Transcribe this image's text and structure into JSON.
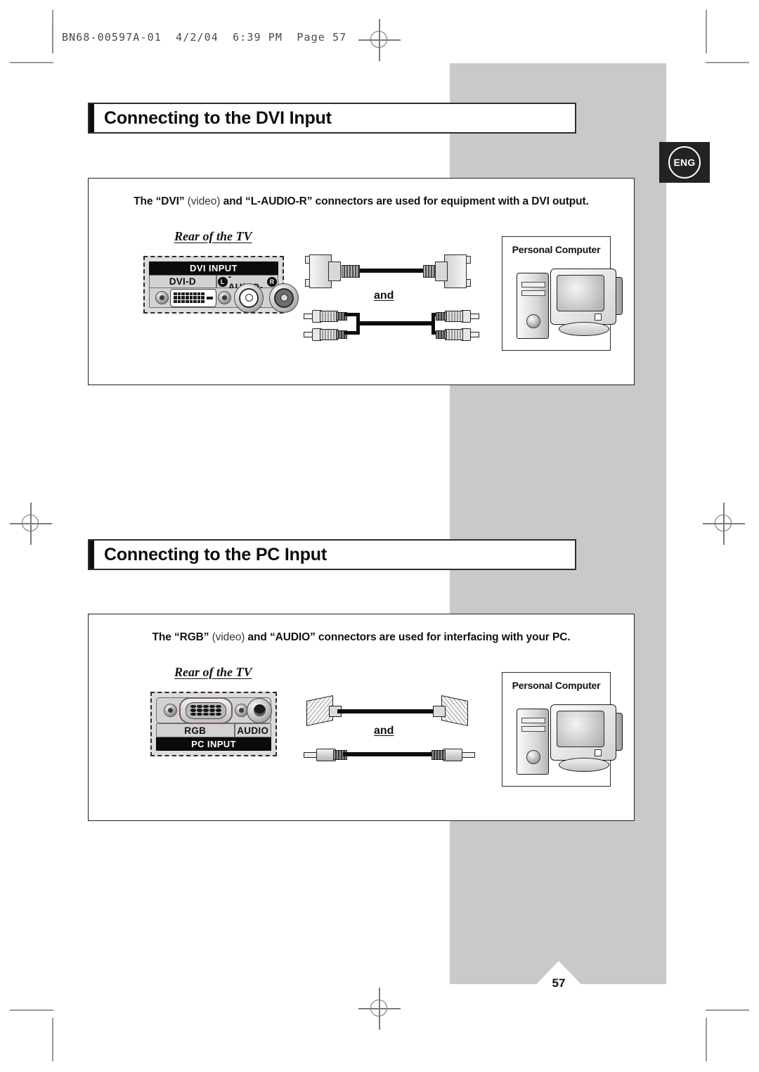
{
  "print_header": {
    "text": "BN68-00597A-01  4/2/04  6:39 PM  Page 57"
  },
  "language_badge": {
    "label": "ENG"
  },
  "sections": [
    {
      "id": "dvi",
      "title": "Connecting to the DVI Input",
      "description_prefix": "The “DVI” ",
      "description_light": "(video)",
      "description_suffix": " and “L-AUDIO-R” connectors are used for equipment with a DVI output.",
      "rear_label": "Rear of the TV",
      "panel": {
        "header_bar": "DVI INPUT",
        "label_left": "DVI-D",
        "label_right_text": "-AUDIO-",
        "label_right_l": "L",
        "label_right_r": "R",
        "header_position": "top"
      },
      "cable": {
        "connector_word": "and",
        "top_cable": "dvi-cable",
        "bottom_cable": "stereo-rca-cable"
      },
      "device_box": {
        "label": "Personal Computer"
      }
    },
    {
      "id": "pc",
      "title": "Connecting to the PC Input",
      "description_prefix": "The “RGB” ",
      "description_light": "(video)",
      "description_suffix": " and “AUDIO” connectors are used for interfacing with your PC.",
      "rear_label": "Rear of the TV",
      "panel": {
        "header_bar": "PC INPUT",
        "label_left": "RGB",
        "label_right_text": "AUDIO",
        "header_position": "bottom"
      },
      "cable": {
        "connector_word": "and",
        "top_cable": "dsub-vga-cable",
        "bottom_cable": "stereo-mini-jack-cable"
      },
      "device_box": {
        "label": "Personal Computer"
      }
    }
  ],
  "page_number": "57",
  "colors": {
    "gray_band": "#c9c9c9",
    "badge_background": "#232323",
    "title_bar": "#101010",
    "panel_face": "#d2d2d2"
  }
}
